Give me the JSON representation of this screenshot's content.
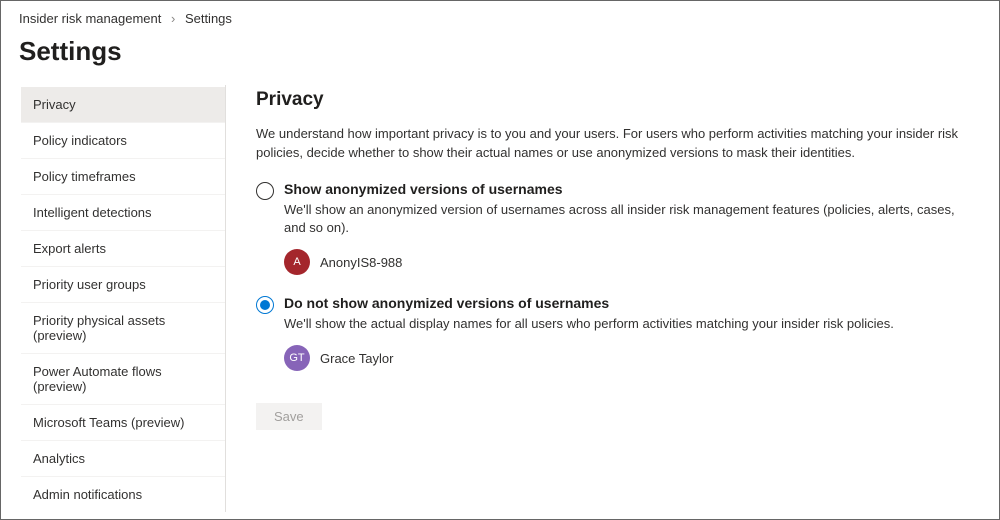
{
  "breadcrumb": {
    "root": "Insider risk management",
    "current": "Settings"
  },
  "page_title": "Settings",
  "sidebar": {
    "items": [
      {
        "label": "Privacy",
        "active": true
      },
      {
        "label": "Policy indicators",
        "active": false
      },
      {
        "label": "Policy timeframes",
        "active": false
      },
      {
        "label": "Intelligent detections",
        "active": false
      },
      {
        "label": "Export alerts",
        "active": false
      },
      {
        "label": "Priority user groups",
        "active": false
      },
      {
        "label": "Priority physical assets (preview)",
        "active": false
      },
      {
        "label": "Power Automate flows (preview)",
        "active": false
      },
      {
        "label": "Microsoft Teams (preview)",
        "active": false
      },
      {
        "label": "Analytics",
        "active": false
      },
      {
        "label": "Admin notifications",
        "active": false
      }
    ]
  },
  "main": {
    "section_title": "Privacy",
    "intro": "We understand how important privacy is to you and your users. For users who perform activities matching your insider risk policies, decide whether to show their actual names or use anonymized versions to mask their identities.",
    "options": [
      {
        "label": "Show anonymized versions of usernames",
        "desc": "We'll show an anonymized version of usernames across all insider risk management features (policies, alerts, cases, and so on).",
        "selected": false,
        "avatar_initials": "A",
        "avatar_color": "red",
        "example_name": "AnonyIS8-988"
      },
      {
        "label": "Do not show anonymized versions of usernames",
        "desc": "We'll show the actual display names for all users who perform activities matching your insider risk policies.",
        "selected": true,
        "avatar_initials": "GT",
        "avatar_color": "purple",
        "example_name": "Grace Taylor"
      }
    ],
    "save_label": "Save"
  }
}
